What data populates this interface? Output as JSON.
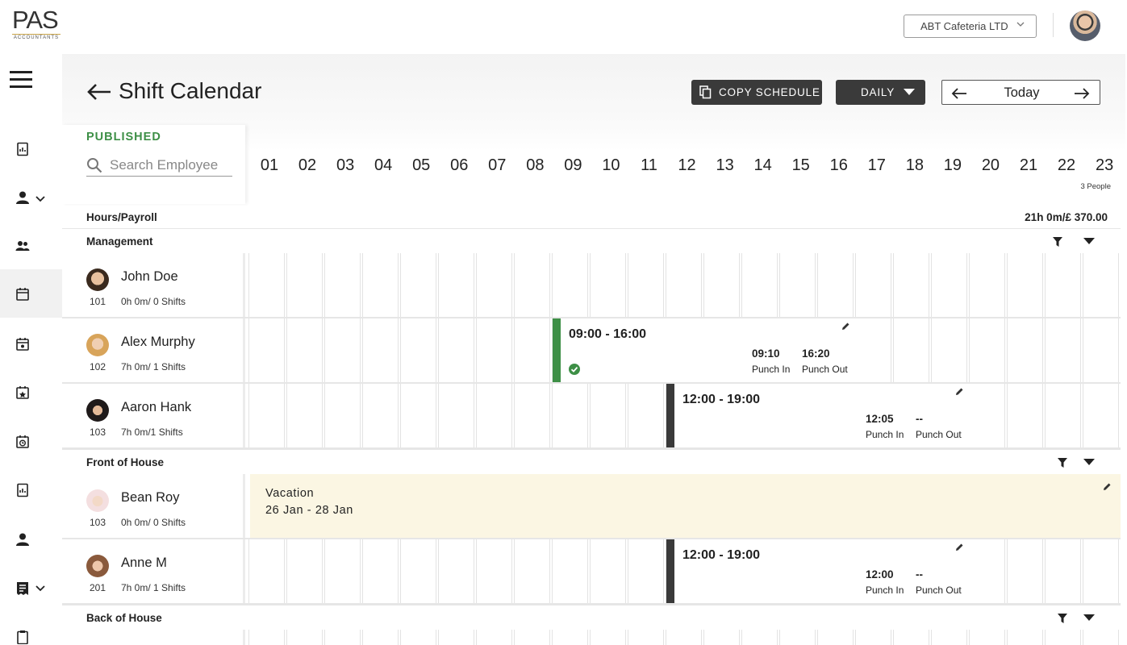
{
  "header": {
    "logo_text": "PAS",
    "logo_sub": "ACCOUNTANTS",
    "company_select": "ABT Cafeteria LTD"
  },
  "sidebar": {
    "icons": [
      "menu-icon",
      "report-icon",
      "user-icon",
      "team-icon",
      "calendar-icon",
      "calendar-check-icon",
      "calendar-star-icon",
      "calendar-clock-icon",
      "report-chart-icon",
      "person-icon",
      "receipt-icon",
      "clipboard-icon"
    ]
  },
  "toolbar": {
    "title": "Shift Calendar",
    "copy_schedule": "COPY SCHEDULE",
    "view_mode": "DAILY",
    "date_label": "Today"
  },
  "schedule": {
    "status": "PUBLISHED",
    "search_placeholder": "Search Employee",
    "hours": [
      "01",
      "02",
      "03",
      "04",
      "05",
      "06",
      "07",
      "08",
      "09",
      "10",
      "11",
      "12",
      "13",
      "14",
      "15",
      "16",
      "17",
      "18",
      "19",
      "20",
      "21",
      "22",
      "23"
    ],
    "people_count": "3 People",
    "hours_label": "Hours/Payroll",
    "hours_total": "21h 0m/£ 370.00"
  },
  "groups": [
    {
      "name": "Management",
      "employees": [
        {
          "name": "John Doe",
          "id": "101",
          "summary": "0h 0m/ 0 Shifts"
        },
        {
          "name": "Alex Murphy",
          "id": "102",
          "summary": "7h 0m/ 1 Shifts",
          "shift": {
            "time": "09:00 - 16:00",
            "punch_in": "09:10",
            "punch_in_label": "Punch In",
            "punch_out": "16:20",
            "punch_out_label": "Punch Out",
            "color": "#3d8f46"
          }
        },
        {
          "name": "Aaron Hank",
          "id": "103",
          "summary": "7h 0m/1 Shifts",
          "shift": {
            "time": "12:00 - 19:00",
            "punch_in": "12:05",
            "punch_in_label": "Punch In",
            "punch_out": "--",
            "punch_out_label": "Punch Out",
            "color": "#3a3a3a"
          }
        }
      ]
    },
    {
      "name": "Front of House",
      "employees": [
        {
          "name": "Bean Roy",
          "id": "103",
          "summary": "0h 0m/ 0 Shifts",
          "vacation": {
            "title": "Vacation",
            "dates": "26 Jan - 28 Jan"
          }
        },
        {
          "name": "Anne M",
          "id": "201",
          "summary": "7h 0m/ 1 Shifts",
          "shift": {
            "time": "12:00 - 19:00",
            "punch_in": "12:00",
            "punch_in_label": "Punch In",
            "punch_out": "--",
            "punch_out_label": "Punch Out",
            "color": "#3a3a3a"
          }
        }
      ]
    },
    {
      "name": "Back of House"
    }
  ],
  "colors": {
    "published": "#3d8f46",
    "accent_dark": "#3a3a3a",
    "vacation_bg": "#fbf6e3"
  }
}
